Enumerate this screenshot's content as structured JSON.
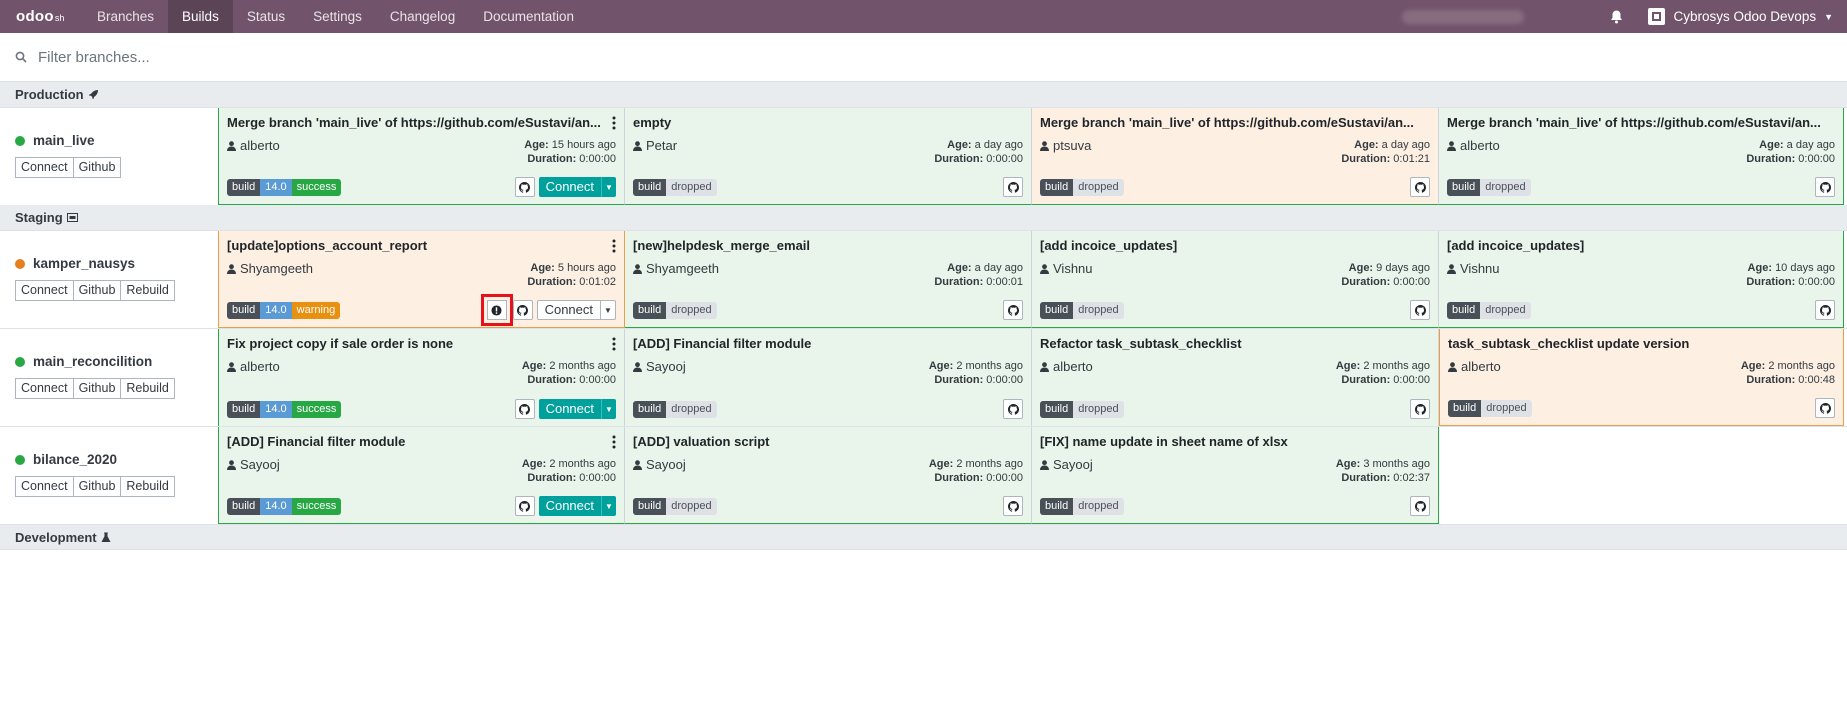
{
  "navbar": {
    "logo_main": "odoo",
    "logo_suffix": "sh",
    "items": [
      {
        "label": "Branches",
        "active": false
      },
      {
        "label": "Builds",
        "active": true
      },
      {
        "label": "Status",
        "active": false
      },
      {
        "label": "Settings",
        "active": false
      },
      {
        "label": "Changelog",
        "active": false
      },
      {
        "label": "Documentation",
        "active": false
      }
    ],
    "user": "Cybrosys Odoo Devops"
  },
  "filter": {
    "placeholder": "Filter branches..."
  },
  "sections": {
    "production": "Production",
    "staging": "Staging",
    "development": "Development"
  },
  "colors": {
    "navbar": "#71546b",
    "success": "#28a745",
    "warning": "#e8900f",
    "teal": "#00a09d"
  },
  "branch_buttons": {
    "connect": "Connect",
    "github": "Github",
    "rebuild": "Rebuild"
  },
  "build_labels": {
    "age": "Age:",
    "duration": "Duration:",
    "build": "build",
    "version": "14.0",
    "success": "success",
    "warning": "warning",
    "dropped": "dropped",
    "connect": "Connect"
  },
  "rows": [
    {
      "branch": "main_live",
      "builds": [
        {
          "title": "Merge branch 'main_live' of https://github.com/eSustavi/an...",
          "user": "alberto",
          "age": "15 hours ago",
          "duration": "0:00:00"
        },
        {
          "title": "empty",
          "user": "Petar",
          "age": "a day ago",
          "duration": "0:00:00"
        },
        {
          "title": "Merge branch 'main_live' of https://github.com/eSustavi/an...",
          "user": "ptsuva",
          "age": "a day ago",
          "duration": "0:01:21"
        },
        {
          "title": "Merge branch 'main_live' of https://github.com/eSustavi/an...",
          "user": "alberto",
          "age": "a day ago",
          "duration": "0:00:00"
        }
      ]
    },
    {
      "branch": "kamper_nausys",
      "builds": [
        {
          "title": "[update]options_account_report",
          "user": "Shyamgeeth",
          "age": "5 hours ago",
          "duration": "0:01:02"
        },
        {
          "title": "[new]helpdesk_merge_email",
          "user": "Shyamgeeth",
          "age": "a day ago",
          "duration": "0:00:01"
        },
        {
          "title": "[add incoice_updates]",
          "user": "Vishnu",
          "age": "9 days ago",
          "duration": "0:00:00"
        },
        {
          "title": "[add incoice_updates]",
          "user": "Vishnu",
          "age": "10 days ago",
          "duration": "0:00:00"
        }
      ]
    },
    {
      "branch": "main_reconcilition",
      "builds": [
        {
          "title": "Fix project copy if sale order is none",
          "user": "alberto",
          "age": "2 months ago",
          "duration": "0:00:00"
        },
        {
          "title": "[ADD] Financial filter module",
          "user": "Sayooj",
          "age": "2 months ago",
          "duration": "0:00:00"
        },
        {
          "title": "Refactor task_subtask_checklist",
          "user": "alberto",
          "age": "2 months ago",
          "duration": "0:00:00"
        },
        {
          "title": "task_subtask_checklist update version",
          "user": "alberto",
          "age": "2 months ago",
          "duration": "0:00:48"
        }
      ]
    },
    {
      "branch": "bilance_2020",
      "builds": [
        {
          "title": "[ADD] Financial filter module",
          "user": "Sayooj",
          "age": "2 months ago",
          "duration": "0:00:00"
        },
        {
          "title": "[ADD] valuation script",
          "user": "Sayooj",
          "age": "2 months ago",
          "duration": "0:00:00"
        },
        {
          "title": "[FIX] name update in sheet name of xlsx",
          "user": "Sayooj",
          "age": "3 months ago",
          "duration": "0:02:37"
        }
      ]
    }
  ]
}
